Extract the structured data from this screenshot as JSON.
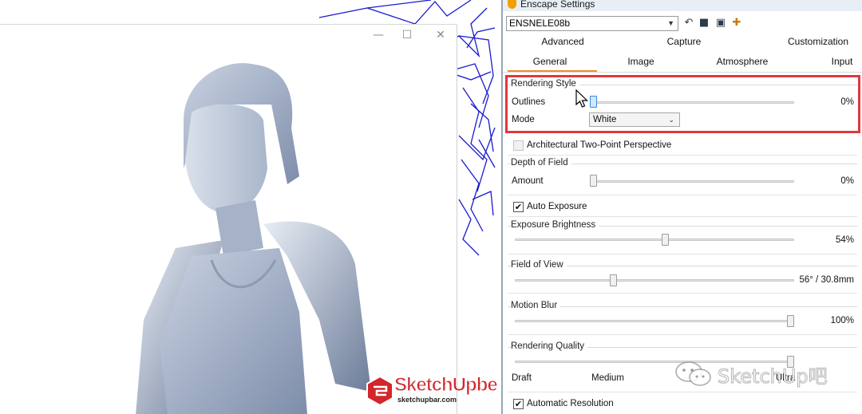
{
  "panel": {
    "title": "Enscape Settings",
    "preset_name": "ENSNELE08b",
    "toolbar_icons": [
      "undo-icon",
      "save-icon",
      "save-as-icon",
      "new-preset-icon"
    ]
  },
  "tabs": {
    "row1": [
      "Advanced",
      "Capture",
      "Customization"
    ],
    "row2": [
      "General",
      "Image",
      "Atmosphere",
      "Input"
    ],
    "active": "General"
  },
  "rendering_style": {
    "title": "Rendering Style",
    "outlines_label": "Outlines",
    "outlines_value": "0%",
    "outlines_fraction": 0.0,
    "mode_label": "Mode",
    "mode_value": "White"
  },
  "two_point": {
    "label": "Architectural Two-Point Perspective",
    "checked": false
  },
  "depth_of_field": {
    "title": "Depth of Field",
    "amount_label": "Amount",
    "amount_value": "0%",
    "amount_fraction": 0.0
  },
  "auto_exposure": {
    "label": "Auto Exposure",
    "checked": true,
    "mark": "✔"
  },
  "exposure_brightness": {
    "title": "Exposure Brightness",
    "value": "54%",
    "fraction": 0.54
  },
  "field_of_view": {
    "title": "Field of View",
    "value": "56° / 30.8mm",
    "fraction": 0.35
  },
  "motion_blur": {
    "title": "Motion Blur",
    "value": "100%",
    "fraction": 1.0
  },
  "rendering_quality": {
    "title": "Rendering Quality",
    "levels": [
      "Draft",
      "Medium",
      "Ultra"
    ],
    "fraction": 1.0
  },
  "automatic_resolution": {
    "label": "Automatic Resolution",
    "checked": true,
    "mark": "✔"
  },
  "watermarks": {
    "logo_title": "SketchUpbe",
    "logo_url": "sketchupbar.com",
    "wechat_text": "SketchUp吧"
  },
  "preview_window": {
    "controls": [
      "—",
      "☐",
      "✕"
    ]
  },
  "colors": {
    "accent": "#f28c28",
    "highlight": "#e0383d",
    "wireframe": "#1a1ad0"
  }
}
